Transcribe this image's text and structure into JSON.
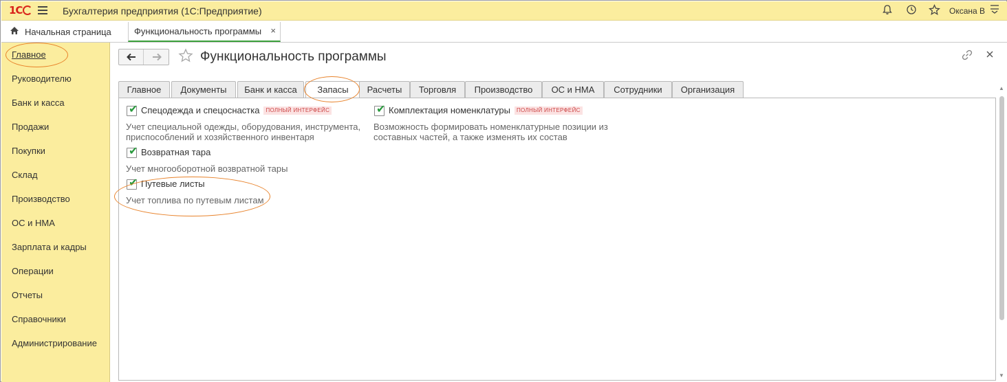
{
  "titlebar": {
    "logo_text": "1С",
    "app_title": "Бухгалтерия предприятия  (1С:Предприятие)",
    "user_name": "Оксана В",
    "icons": [
      "bell-icon",
      "history-icon",
      "star-icon",
      "menu-lines-icon"
    ]
  },
  "open_tabs": {
    "home_label": "Начальная страница",
    "current_label": "Функциональность программы",
    "close_glyph": "×"
  },
  "sidebar": {
    "items": [
      {
        "label": "Главное",
        "active": true
      },
      {
        "label": "Руководителю"
      },
      {
        "label": "Банк и касса"
      },
      {
        "label": "Продажи"
      },
      {
        "label": "Покупки"
      },
      {
        "label": "Склад"
      },
      {
        "label": "Производство"
      },
      {
        "label": "ОС и НМА"
      },
      {
        "label": "Зарплата и кадры"
      },
      {
        "label": "Операции"
      },
      {
        "label": "Отчеты"
      },
      {
        "label": "Справочники"
      },
      {
        "label": "Администрирование"
      }
    ]
  },
  "form": {
    "title": "Функциональность программы",
    "back_glyph": "🡐",
    "fwd_glyph": "🡒",
    "star_glyph": "☆",
    "link_glyph": "🔗",
    "close_glyph": "×"
  },
  "section_tabs": [
    {
      "label": "Главное"
    },
    {
      "label": "Документы"
    },
    {
      "label": "Банк и касса"
    },
    {
      "label": "Запасы",
      "active": true
    },
    {
      "label": "Расчеты"
    },
    {
      "label": "Торговля"
    },
    {
      "label": "Производство"
    },
    {
      "label": "ОС и НМА"
    },
    {
      "label": "Сотрудники"
    },
    {
      "label": "Организация"
    }
  ],
  "options": [
    {
      "label": "Спецодежда и спецоснастка",
      "badge": "ПОЛНЫЙ ИНТЕРФЕЙС",
      "checked": true,
      "desc_line1": "Учет специальной одежды, оборудования, инструмента,",
      "desc_line2": "приспособлений и хозяйственного инвентаря"
    },
    {
      "label": "Комплектация номенклатуры",
      "badge": "ПОЛНЫЙ ИНТЕРФЕЙС",
      "checked": true,
      "desc_line1": "Возможность формировать номенклатурные позиции из",
      "desc_line2": "составных частей, а также изменять их состав"
    },
    {
      "label": "Возвратная тара",
      "checked": true,
      "desc_line1": "Учет многооборотной возвратной тары"
    },
    {
      "label": "Путевые листы",
      "checked": true,
      "desc_line1": "Учет топлива по путевым листам"
    }
  ],
  "colors": {
    "panel_yellow": "#fbed9e",
    "accent_green": "#3aa03a",
    "check_green": "#2a9a3e",
    "annotation_orange": "#e8822a",
    "badge_red": "#c44444"
  }
}
